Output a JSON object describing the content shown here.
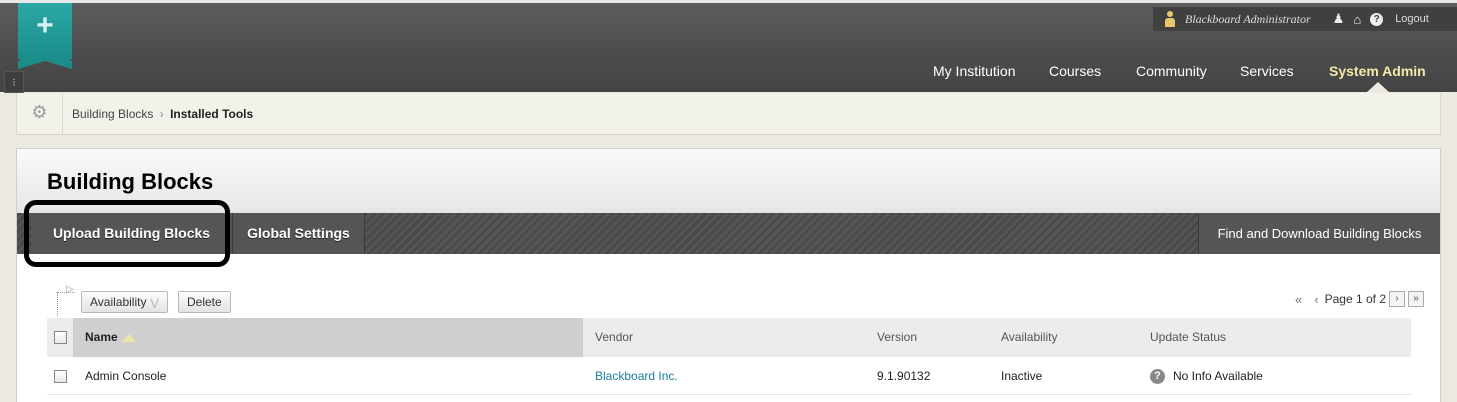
{
  "header": {
    "user_name": "Blackboard Administrator",
    "logout_label": "Logout",
    "tabs": [
      "My Institution",
      "Courses",
      "Community",
      "Services",
      "System Admin"
    ],
    "active_tab": "System Admin"
  },
  "breadcrumb": {
    "parent": "Building Blocks",
    "separator": "›",
    "current": "Installed Tools"
  },
  "page": {
    "title": "Building Blocks",
    "actions": [
      "Upload Building Blocks",
      "Global Settings"
    ],
    "right_action": "Find and Download Building Blocks"
  },
  "toolbar": {
    "availability_label": "Availability",
    "delete_label": "Delete",
    "pager_text": "Page 1 of 2"
  },
  "table": {
    "columns": [
      "Name",
      "Vendor",
      "Version",
      "Availability",
      "Update Status"
    ],
    "rows": [
      {
        "name": "Admin Console",
        "vendor": "Blackboard Inc.",
        "version": "9.1.90132",
        "availability": "Inactive",
        "update_status": "No Info Available"
      }
    ]
  },
  "colors": {
    "header_bg": "#4c4c4c",
    "brand_teal": "#1b8c8a",
    "active_tab": "#f4e9a6",
    "link": "#1a7d9c"
  }
}
